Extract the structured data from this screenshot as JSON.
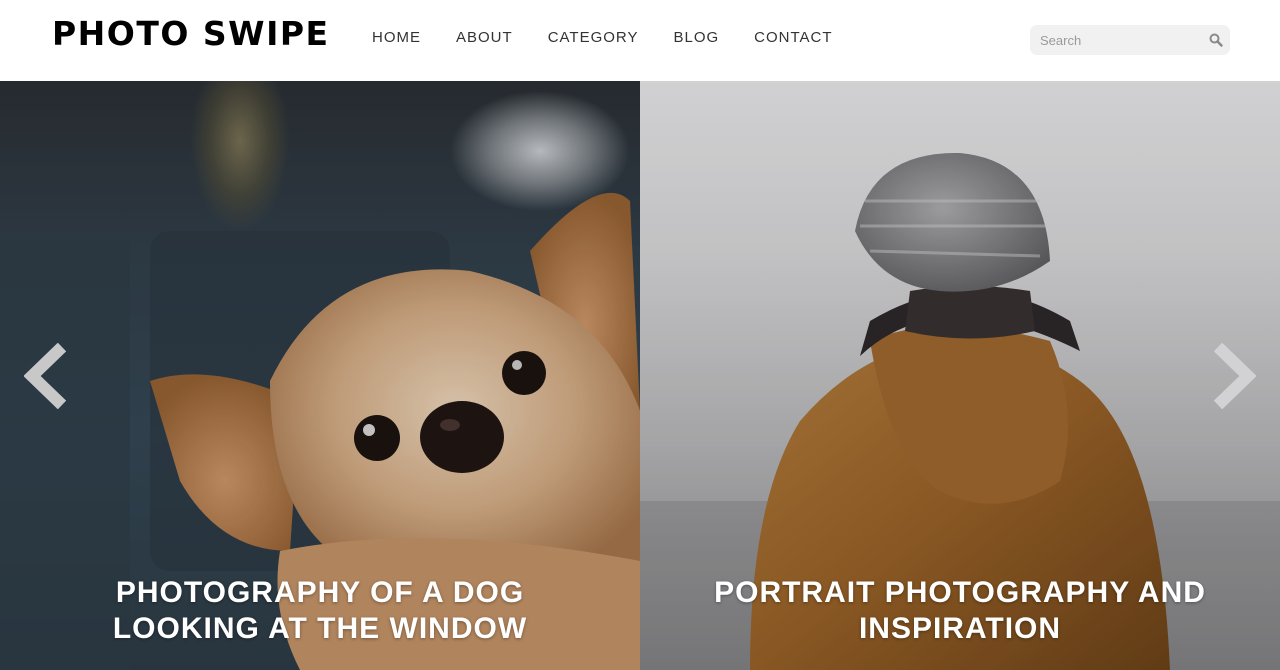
{
  "header": {
    "logo": "PHOTO SWIPE",
    "nav": [
      "HOME",
      "ABOUT",
      "CATEGORY",
      "BLOG",
      "CONTACT"
    ],
    "search_placeholder": "Search",
    "search_icon": "search-icon"
  },
  "slider": {
    "slides": [
      {
        "caption_line1": "PHOTOGRAPHY OF A DOG",
        "caption_line2": "LOOKING AT THE WINDOW",
        "image": "dog-photo"
      },
      {
        "caption_line1": "PORTRAIT PHOTOGRAPHY AND",
        "caption_line2": "INSPIRATION",
        "image": "person-in-beanie-photo"
      }
    ],
    "prev_icon": "chevron-left-icon",
    "next_icon": "chevron-right-icon"
  },
  "colors": {
    "caption_text": "#ffffff",
    "nav_text": "#333333",
    "logo_text": "#000000",
    "search_bg": "#f1f1f1"
  }
}
